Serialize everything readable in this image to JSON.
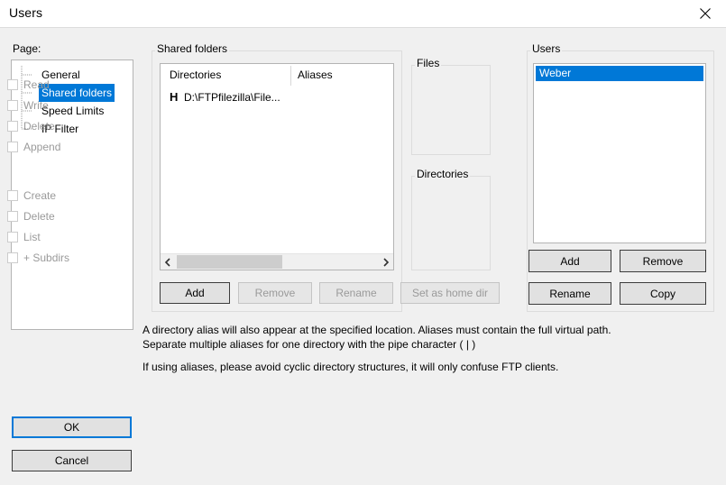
{
  "window": {
    "title": "Users",
    "close_icon": "close-icon"
  },
  "page_panel": {
    "label": "Page:",
    "items": [
      {
        "label": "General",
        "selected": false
      },
      {
        "label": "Shared folders",
        "selected": true
      },
      {
        "label": "Speed Limits",
        "selected": false
      },
      {
        "label": "IP Filter",
        "selected": false
      }
    ]
  },
  "shared_folders": {
    "label": "Shared folders",
    "columns": [
      "Directories",
      "Aliases"
    ],
    "rows": [
      {
        "home_flag": "H",
        "path": "D:\\FTPfilezilla\\File...",
        "alias": ""
      }
    ],
    "scrollbar": {
      "left_arrow": "chevron-left-icon",
      "right_arrow": "chevron-right-icon"
    },
    "buttons": [
      {
        "label": "Add",
        "enabled": true
      },
      {
        "label": "Remove",
        "enabled": false
      },
      {
        "label": "Rename",
        "enabled": false
      },
      {
        "label": "Set as home dir",
        "enabled": false
      }
    ]
  },
  "permissions": {
    "files": {
      "label": "Files",
      "items": [
        {
          "label": "Read",
          "checked": false,
          "enabled": false
        },
        {
          "label": "Write",
          "checked": false,
          "enabled": false
        },
        {
          "label": "Delete",
          "checked": false,
          "enabled": false
        },
        {
          "label": "Append",
          "checked": false,
          "enabled": false
        }
      ]
    },
    "directories": {
      "label": "Directories",
      "items": [
        {
          "label": "Create",
          "checked": false,
          "enabled": false
        },
        {
          "label": "Delete",
          "checked": false,
          "enabled": false
        },
        {
          "label": "List",
          "checked": false,
          "enabled": false
        },
        {
          "label": "+ Subdirs",
          "checked": false,
          "enabled": false
        }
      ]
    }
  },
  "users_panel": {
    "label": "Users",
    "items": [
      {
        "label": "Weber",
        "selected": true
      }
    ],
    "buttons": [
      {
        "label": "Add",
        "enabled": true
      },
      {
        "label": "Remove",
        "enabled": true
      },
      {
        "label": "Rename",
        "enabled": true
      },
      {
        "label": "Copy",
        "enabled": true
      }
    ]
  },
  "description": {
    "line1": "A directory alias will also appear at the specified location. Aliases must contain the full virtual path. Separate multiple aliases for one directory with the pipe character ( | )",
    "line2": "If using aliases, please avoid cyclic directory structures, it will only confuse FTP clients."
  },
  "dialog_buttons": {
    "ok": "OK",
    "cancel": "Cancel"
  },
  "colors": {
    "selection_blue": "#0078d7",
    "window_bg": "#f0f0f0",
    "button_face": "#e1e1e1"
  }
}
